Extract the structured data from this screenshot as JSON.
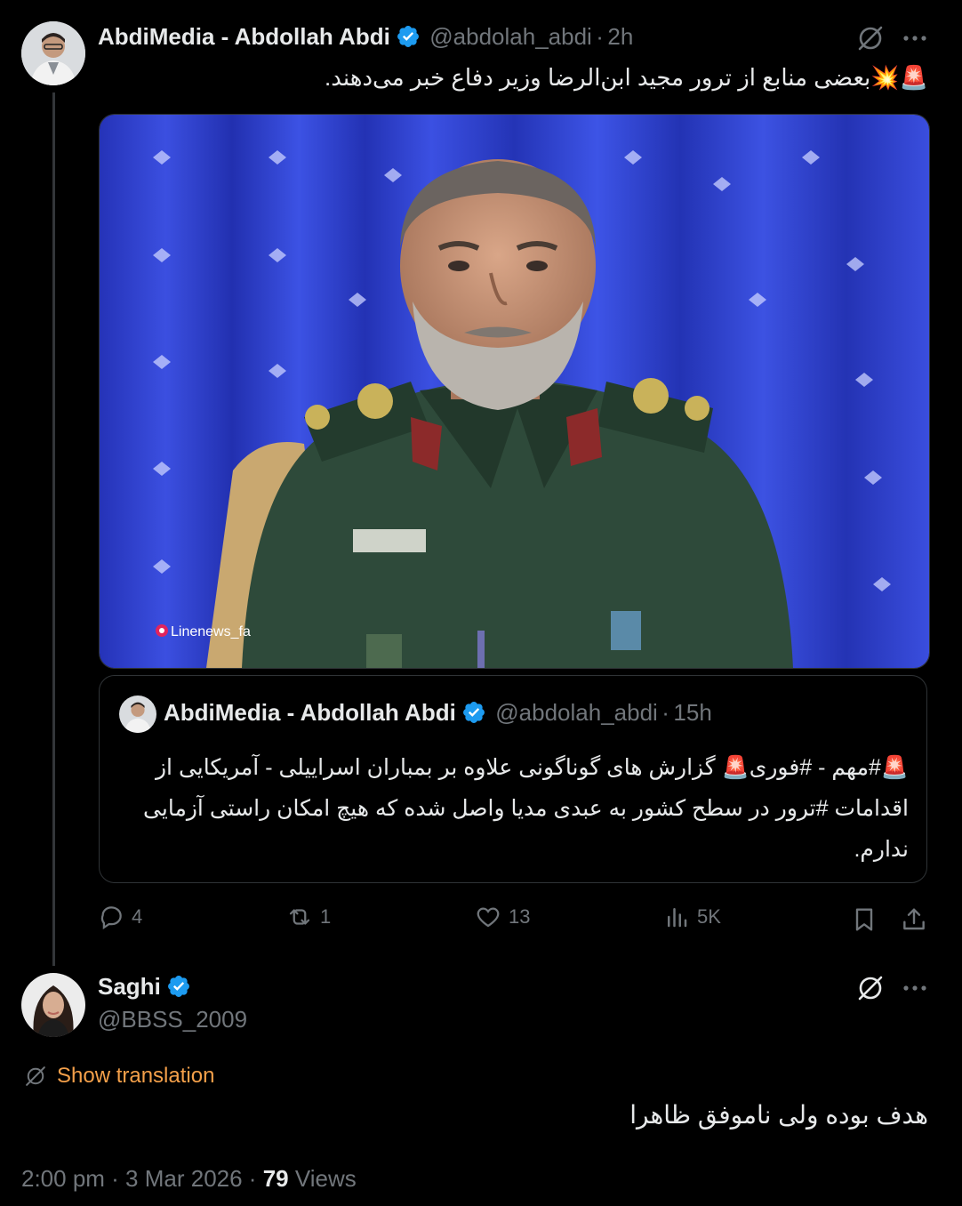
{
  "tweet": {
    "author_name": "AbdiMedia - Abdollah Abdi",
    "author_handle": "@abdolah_abdi",
    "time_sep": "·",
    "time": "2h",
    "text": "🚨💥بعضی منابع از ترور مجید ابن‌الرضا وزیر دفاع خبر می‌دهند.",
    "image_watermark": "Linenews_fa",
    "quote": {
      "author_name": "AbdiMedia - Abdollah Abdi",
      "author_handle": "@abdolah_abdi",
      "time_sep": "·",
      "time": "15h",
      "text": "🚨#مهم - #فوری🚨 گزارش های گوناگونی علاوه بر بمباران اسراییلی - آمریکایی از اقدامات #ترور در سطح کشور به عبدی مدیا واصل شده که هیچ امکان راستی آزمایی ندارم."
    },
    "stats": {
      "replies": "4",
      "reposts": "1",
      "likes": "13",
      "views": "5K"
    }
  },
  "reply": {
    "author_name": "Saghi",
    "author_handle": "@BBSS_2009",
    "show_translation": "Show translation",
    "text": "هدف بوده ولی ناموفق ظاهرا",
    "timestamp": "2:00 pm · 3 Mar 2026 ·",
    "views_count": "79",
    "views_label": "Views"
  },
  "colors": {
    "background": "#000000",
    "verified": "#1d9bf0",
    "secondary_text": "#71767b",
    "translation_link": "#f4a04a",
    "border": "#2f3336"
  }
}
